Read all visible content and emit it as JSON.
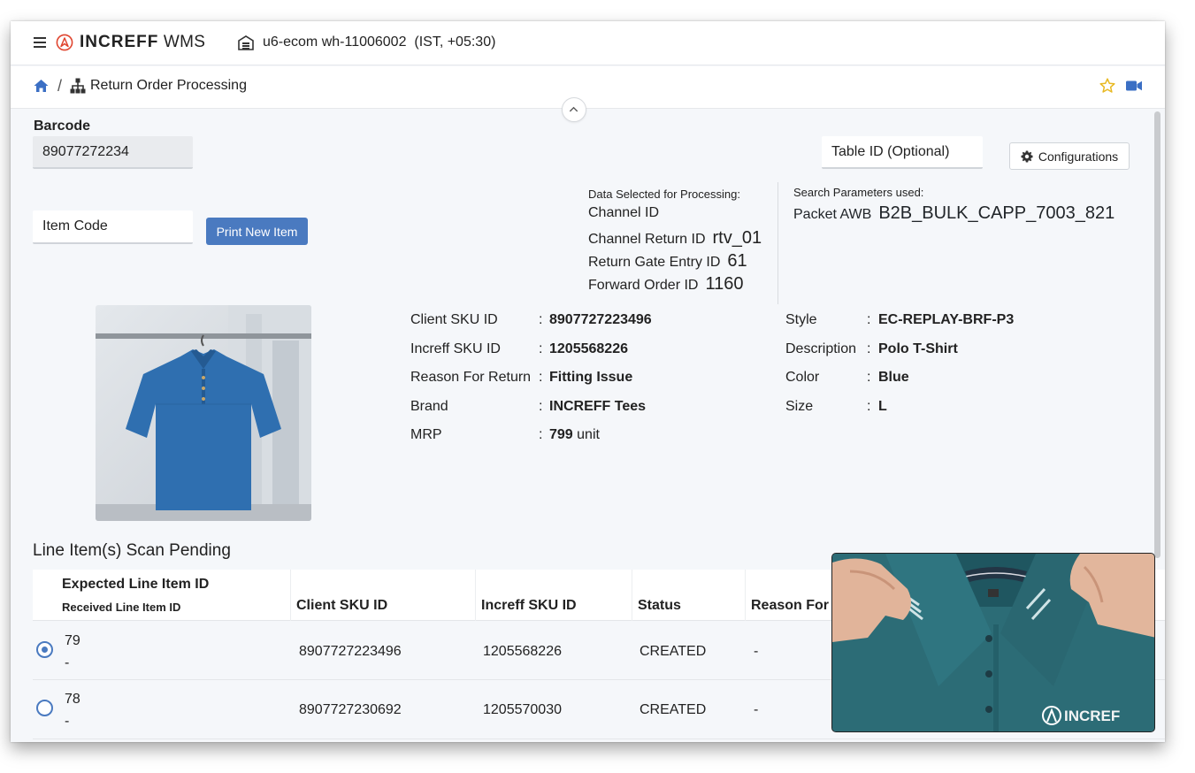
{
  "app": {
    "brand_bold": "INCREFF",
    "brand_suffix": "WMS",
    "warehouse": "u6-ecom wh-11006002",
    "timezone": "(IST, +05:30)"
  },
  "breadcrumb": {
    "separator": "/",
    "title": "Return Order Processing"
  },
  "form": {
    "barcode_label": "Barcode",
    "barcode_value": "89077272234",
    "item_code_placeholder": "Item Code",
    "print_button": "Print New Item",
    "table_id_placeholder": "Table ID (Optional)",
    "config_button": "Configurations"
  },
  "selected": {
    "heading": "Data Selected for Processing:",
    "rows": [
      {
        "label": "Channel ID",
        "value": ""
      },
      {
        "label": "Channel Return ID",
        "value": "rtv_01"
      },
      {
        "label": "Return Gate Entry ID",
        "value": "61"
      },
      {
        "label": "Forward Order ID",
        "value": "1160"
      }
    ]
  },
  "search": {
    "heading": "Search Parameters used:",
    "label": "Packet AWB",
    "value": "B2B_BULK_CAPP_7003_821"
  },
  "details": {
    "left": [
      {
        "label": "Client SKU ID",
        "value": "8907727223496",
        "suffix": ""
      },
      {
        "label": "Increff SKU ID",
        "value": "1205568226",
        "suffix": ""
      },
      {
        "label": "Reason For Return",
        "value": "Fitting Issue",
        "suffix": ""
      },
      {
        "label": "Brand",
        "value": "INCREFF Tees",
        "suffix": ""
      },
      {
        "label": "MRP",
        "value": "799",
        "suffix": "unit"
      }
    ],
    "right": [
      {
        "label": "Style",
        "value": "EC-REPLAY-BRF-P3"
      },
      {
        "label": "Description",
        "value": "Polo T-Shirt"
      },
      {
        "label": "Color",
        "value": "Blue"
      },
      {
        "label": "Size",
        "value": "L"
      }
    ],
    "colon": ":"
  },
  "table": {
    "title": "Line Item(s) Scan Pending",
    "header_top": "Expected Line Item ID",
    "header_sub": "Received Line Item ID",
    "columns": [
      "Client SKU ID",
      "Increff SKU ID",
      "Status",
      "Reason For"
    ],
    "rows": [
      {
        "expected": "79",
        "received": "-",
        "client_sku": "8907727223496",
        "increff_sku": "1205568226",
        "status": "CREATED",
        "reason": "-",
        "selected": true
      },
      {
        "expected": "78",
        "received": "-",
        "client_sku": "8907727230692",
        "increff_sku": "1205570030",
        "status": "CREATED",
        "reason": "-",
        "selected": false
      }
    ]
  },
  "video_overlay": {
    "brand_text": "INCREF"
  },
  "colors": {
    "primary": "#4a7ac0",
    "logo_red": "#e0452f",
    "star": "#e8b923",
    "shirt": "#2f6fb0"
  },
  "icons": [
    "hamburger-icon",
    "increff-logo-icon",
    "warehouse-icon",
    "home-icon",
    "sitemap-icon",
    "star-icon",
    "video-camera-icon",
    "chevron-up-icon",
    "gear-icon"
  ]
}
